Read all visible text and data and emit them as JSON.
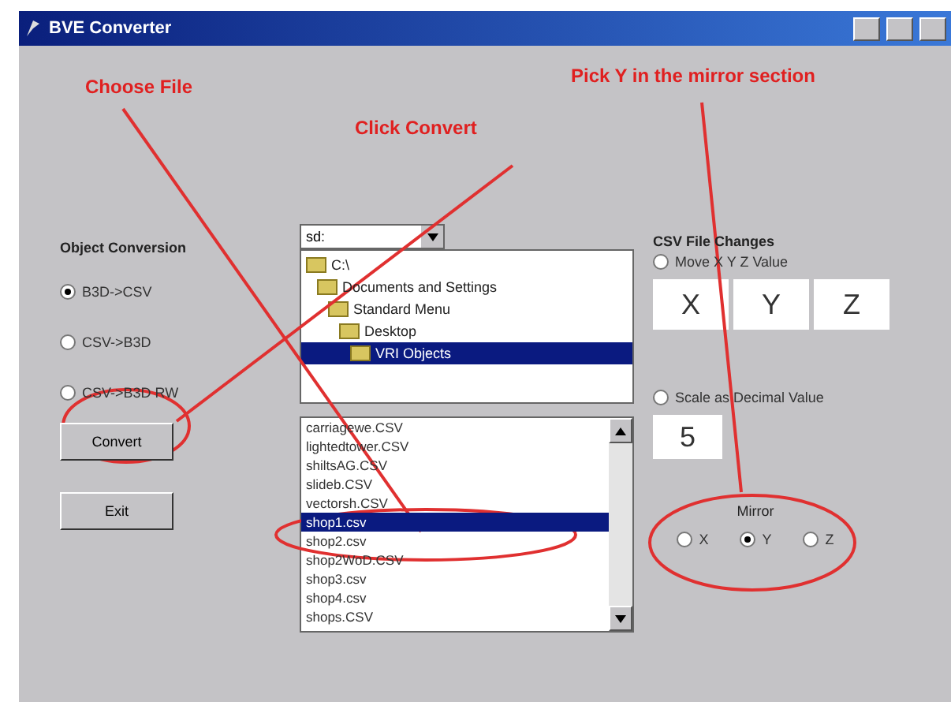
{
  "window": {
    "title": "BVE Converter"
  },
  "annotations": [
    {
      "text": "Choose File"
    },
    {
      "text": "Click Convert"
    },
    {
      "text": "Pick Y in the mirror section"
    }
  ],
  "conversion": {
    "title": "Object Conversion",
    "options": [
      {
        "label": "B3D->CSV",
        "selected": true
      },
      {
        "label": "CSV->B3D",
        "selected": false
      },
      {
        "label": "CSV->B3D RW",
        "selected": false
      }
    ],
    "buttons": [
      "Convert",
      "Exit"
    ]
  },
  "file_browser": {
    "drive": "sd:",
    "folders": [
      {
        "label": "C:\\",
        "selected": false,
        "children": [
          {
            "label": "Documents and Settings",
            "selected": false,
            "children": [
              {
                "label": "Standard Menu",
                "selected": false,
                "children": [
                  {
                    "label": "Desktop",
                    "selected": false,
                    "children": [
                      {
                        "label": "VRI Objects",
                        "selected": true
                      }
                    ]
                  }
                ]
              }
            ]
          }
        ]
      }
    ],
    "files": [
      {
        "label": "carriagewe.CSV",
        "selected": false
      },
      {
        "label": "lightedtower.CSV",
        "selected": false
      },
      {
        "label": "shiltsAG.CSV",
        "selected": false
      },
      {
        "label": "slideb.CSV",
        "selected": false
      },
      {
        "label": "vectorsh.CSV",
        "selected": false
      },
      {
        "label": "shop1.csv",
        "selected": true
      },
      {
        "label": "shop2.csv",
        "selected": false
      },
      {
        "label": "shop2WoD.CSV",
        "selected": false
      },
      {
        "label": "shop3.csv",
        "selected": false
      },
      {
        "label": "shop4.csv",
        "selected": false
      },
      {
        "label": "shops.CSV",
        "selected": false
      }
    ]
  },
  "csv_changes": {
    "title": "CSV File Changes",
    "move": {
      "label": "Move X Y Z Value",
      "checked": false
    },
    "fields": [
      "X",
      "Y",
      "Z"
    ],
    "scale": {
      "label": "Scale as Decimal Value",
      "checked": false
    },
    "scale_value": "5",
    "mirror": {
      "title": "Mirror",
      "options": [
        {
          "label": "X",
          "selected": false
        },
        {
          "label": "Y",
          "selected": true
        },
        {
          "label": "Z",
          "selected": false
        }
      ]
    }
  }
}
